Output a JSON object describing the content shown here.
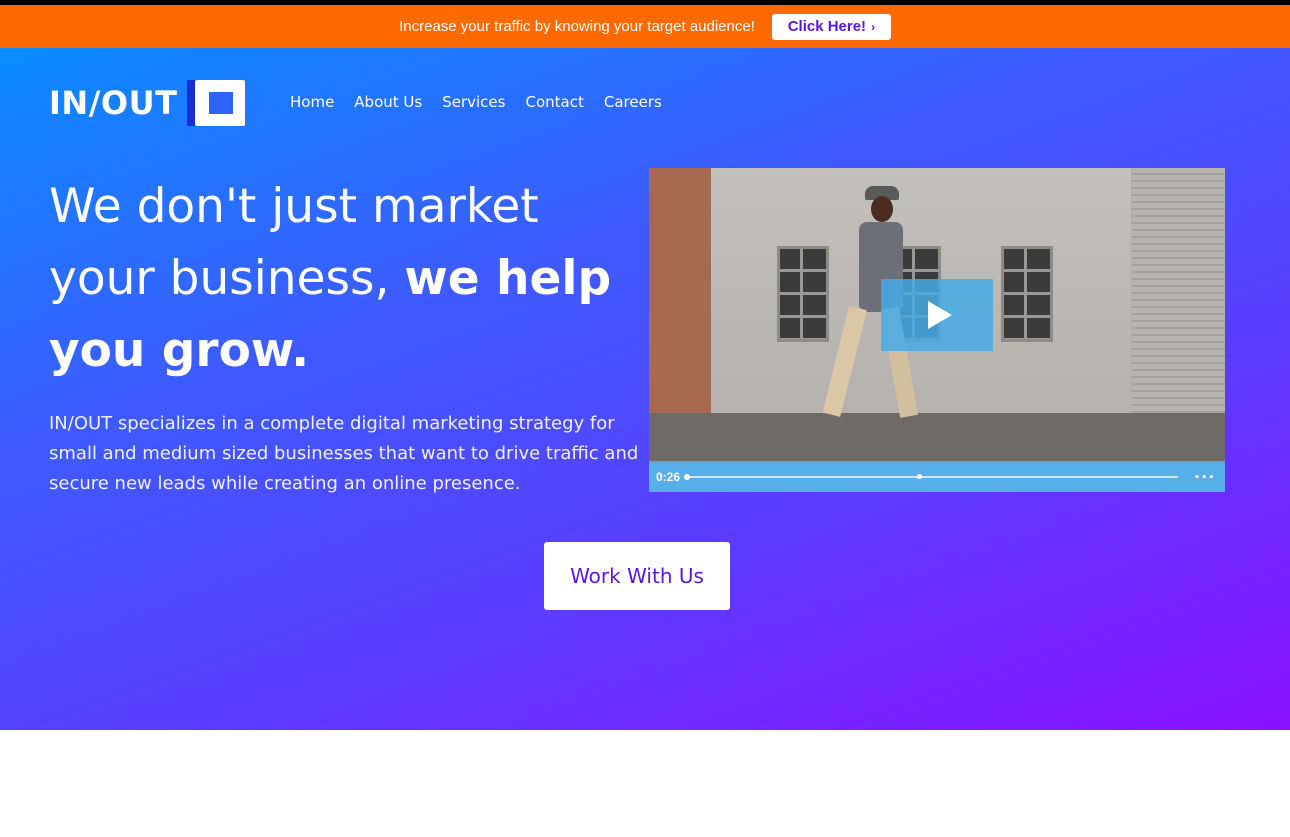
{
  "promo": {
    "text": "Increase your traffic by knowing your target audience!",
    "button_label": "Click Here!",
    "button_icon": "chevron-right-icon"
  },
  "logo": {
    "text": "IN/OUT"
  },
  "nav": {
    "items": [
      {
        "label": "Home"
      },
      {
        "label": "About Us"
      },
      {
        "label": "Services"
      },
      {
        "label": "Contact"
      },
      {
        "label": "Careers"
      }
    ]
  },
  "hero": {
    "headline_regular": "We don't just market your business,",
    "headline_bold": "we help you grow.",
    "description": "IN/OUT specializes in a complete digital marketing strategy for small and medium sized businesses that want to drive traffic and secure new leads while creating an online presence.",
    "cta_label": "Work With Us"
  },
  "video": {
    "timecode": "0:26",
    "play_icon": "play-icon",
    "more_icon": "more-options-icon"
  },
  "colors": {
    "promo_bg": "#ff6a00",
    "hero_gradient_start": "#0a8cff",
    "hero_gradient_end": "#8a10ff",
    "accent_text": "#5a17e0",
    "video_overlay": "#46aae6"
  }
}
